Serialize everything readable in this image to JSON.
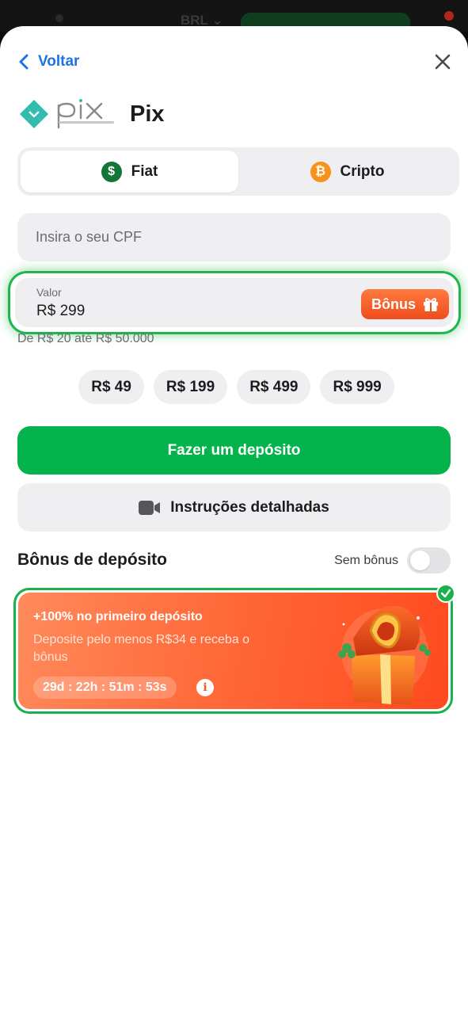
{
  "header": {
    "back_label": "Voltar",
    "method_title": "Pix"
  },
  "tabs": [
    {
      "label": "Fiat",
      "icon": "dollar-coin-icon",
      "active": true
    },
    {
      "label": "Cripto",
      "icon": "bitcoin-icon",
      "active": false
    }
  ],
  "cpf_input": {
    "placeholder": "Insira o seu CPF",
    "value": ""
  },
  "amount": {
    "label": "Valor",
    "value": "R$ 299",
    "bonus_button_label": "Bônus",
    "range_text": "De R$ 20 até R$ 50.000"
  },
  "presets": [
    "R$ 49",
    "R$ 199",
    "R$ 499",
    "R$ 999"
  ],
  "actions": {
    "deposit_label": "Fazer um depósito",
    "instructions_label": "Instruções detalhadas"
  },
  "bonus_section": {
    "title": "Bônus de depósito",
    "no_bonus_label": "Sem bônus",
    "no_bonus_enabled": false
  },
  "promo": {
    "title": "+100% no primeiro depósito",
    "description": "Deposite pelo menos R$34 e receba o bônus",
    "timer": "29d : 22h : 51m : 53s",
    "selected": true
  },
  "colors": {
    "accent_blue": "#1b74e4",
    "primary_green": "#05b34c",
    "highlight_green": "#21b64b",
    "bonus_orange": "#f04c1e",
    "pix_teal": "#32bcad"
  }
}
